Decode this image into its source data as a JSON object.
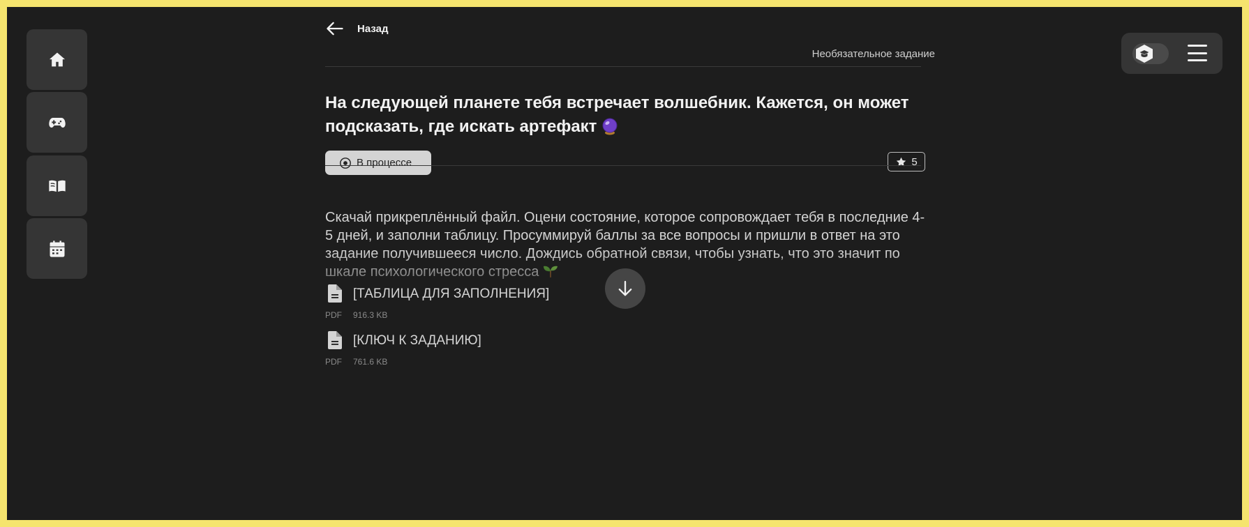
{
  "nav": {
    "back_label": "Назад"
  },
  "task": {
    "kind": "Необязательное задание",
    "title": "На следующей планете тебя встречает волшебник. Кажется, он может подсказать, где искать артефакт",
    "status": "В процессе",
    "points": "5",
    "description": "Скачай прикреплённый файл. Оцени состояние, которое сопровождает тебя в последние 4-5 дней, и заполни таблицу. Просуммируй баллы за все вопросы и пришли в ответ на это задание получившееся число. Дождись обратной связи, чтобы узнать, что это значит по шкале психологического стресса"
  },
  "attachments": [
    {
      "name": "[ТАБЛИЦА ДЛЯ ЗАПОЛНЕНИЯ]",
      "type": "PDF",
      "size": "916.3 KB"
    },
    {
      "name": "[КЛЮЧ К ЗАДАНИЮ]",
      "type": "PDF",
      "size": "761.6 KB"
    }
  ],
  "sidebar": {
    "items": [
      {
        "icon": "home-icon"
      },
      {
        "icon": "gamepad-icon"
      },
      {
        "icon": "book-icon"
      },
      {
        "icon": "calendar-icon"
      }
    ]
  },
  "colors": {
    "background": "#1d1d1d",
    "frame_border": "#f5e46e",
    "panel": "#353535",
    "status_badge": "#d4d4d4"
  }
}
